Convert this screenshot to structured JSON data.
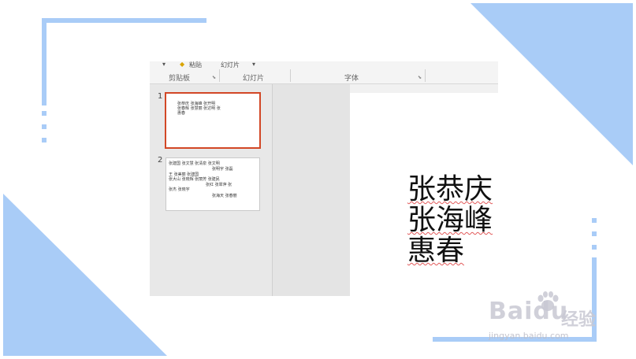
{
  "colors": {
    "accent_blue": "#a9ccf7",
    "frame_blue": "#7fb3f0",
    "selection": "#d24726",
    "spell_underline": "#e25a5a"
  },
  "ribbon": {
    "top_items": [
      "粘贴",
      "幻灯片"
    ],
    "groups": [
      "剪贴板",
      "幻灯片",
      "字体"
    ]
  },
  "thumbnails": [
    {
      "number": "1",
      "selected": true,
      "lines": [
        "张恭庆 张海峰 张开明",
        "张春辉 张慧丽 张达明 张",
        "惠春"
      ]
    },
    {
      "number": "2",
      "selected": false,
      "lines": [
        "张建国 张文慧 张清泉 张文明",
        "张明宇 张磊",
        "王 张美丽 张建国",
        "张大山 张晓辉 张丽芳 张建民",
        "张红 张翠萍 张",
        "张杰 张晓宇",
        "张海天 张春丽"
      ]
    }
  ],
  "slide": {
    "names": [
      "张恭庆",
      "张海峰",
      "惠春"
    ]
  },
  "watermark": {
    "logo": "Baidu",
    "logo_cn": "经验",
    "url": "jingyan.baidu.com"
  }
}
